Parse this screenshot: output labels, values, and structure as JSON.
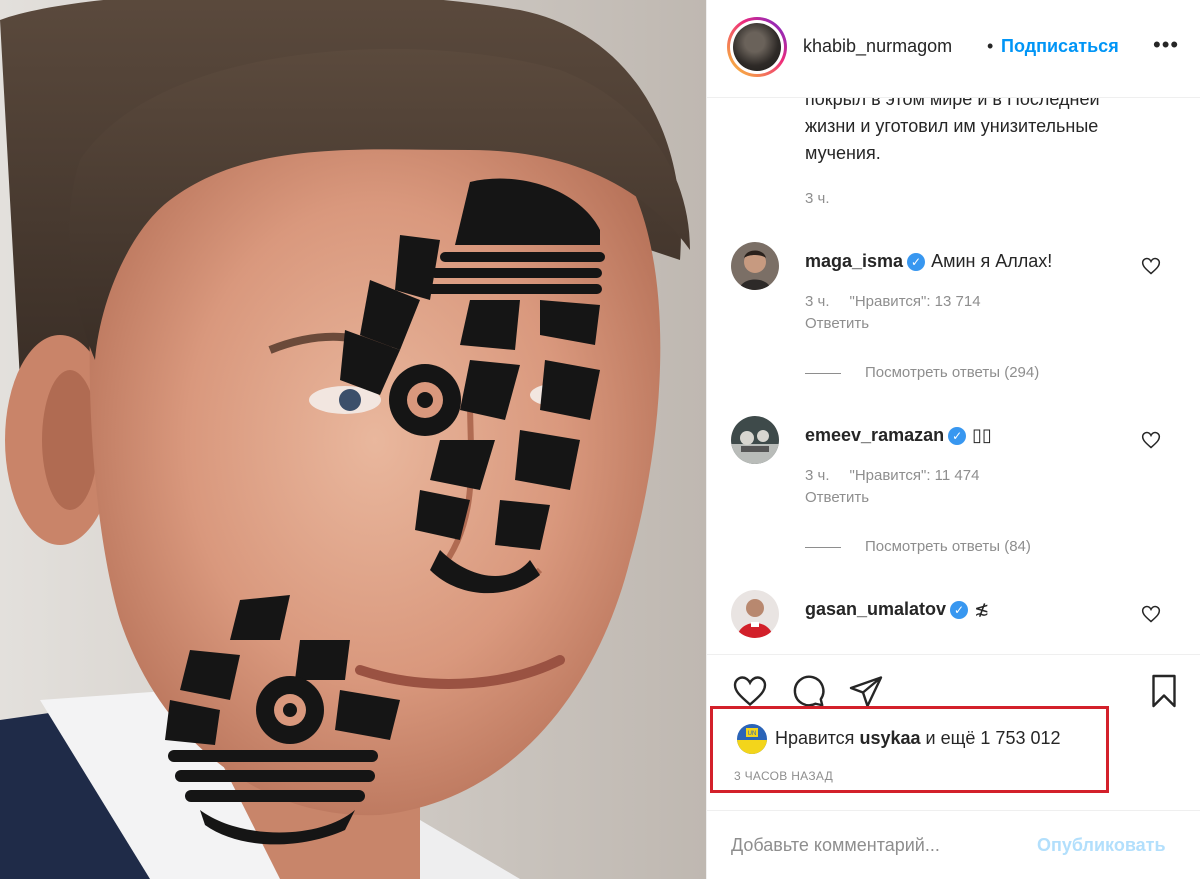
{
  "post": {
    "image_description_icon": "boot-sole-print-on-face-photo"
  },
  "header": {
    "username": "khabib_nurmagom",
    "separator": "•",
    "follow_label": "Подписаться",
    "more_label": "•••"
  },
  "caption": {
    "lines": [
      "покрыл в этом мире и в Последней",
      "жизни и уготовил им унизительные",
      "мучения."
    ],
    "time": "3 ч."
  },
  "comments": [
    {
      "username": "maga_isma",
      "verified": true,
      "text": "Амин я Аллах!",
      "time": "3 ч.",
      "likes": "\"Нравится\": 13 714",
      "reply_label": "Ответить",
      "view_replies": "Посмотреть ответы (294)"
    },
    {
      "username": "emeev_ramazan",
      "verified": true,
      "text": "▯▯",
      "time": "3 ч.",
      "likes": "\"Нравится\": 11 474",
      "reply_label": "Ответить",
      "view_replies": "Посмотреть ответы (84)"
    },
    {
      "username": "gasan_umalatov",
      "verified": true,
      "text": "≴"
    }
  ],
  "actions": {
    "like_icon": "heart-icon",
    "comment_icon": "comment-icon",
    "share_icon": "paper-plane-icon",
    "save_icon": "bookmark-icon"
  },
  "likes": {
    "prefix": "Нравится",
    "user": "usykaa",
    "suffix": "и ещё 1 753 012",
    "time": "3 ЧАСОВ НАЗАД"
  },
  "comment_input": {
    "placeholder": "Добавьте комментарий...",
    "post_label": "Опубликовать"
  },
  "colors": {
    "accent": "#0095f6",
    "highlight_box": "#d3202a",
    "secondary_text": "#8e8e8e"
  }
}
